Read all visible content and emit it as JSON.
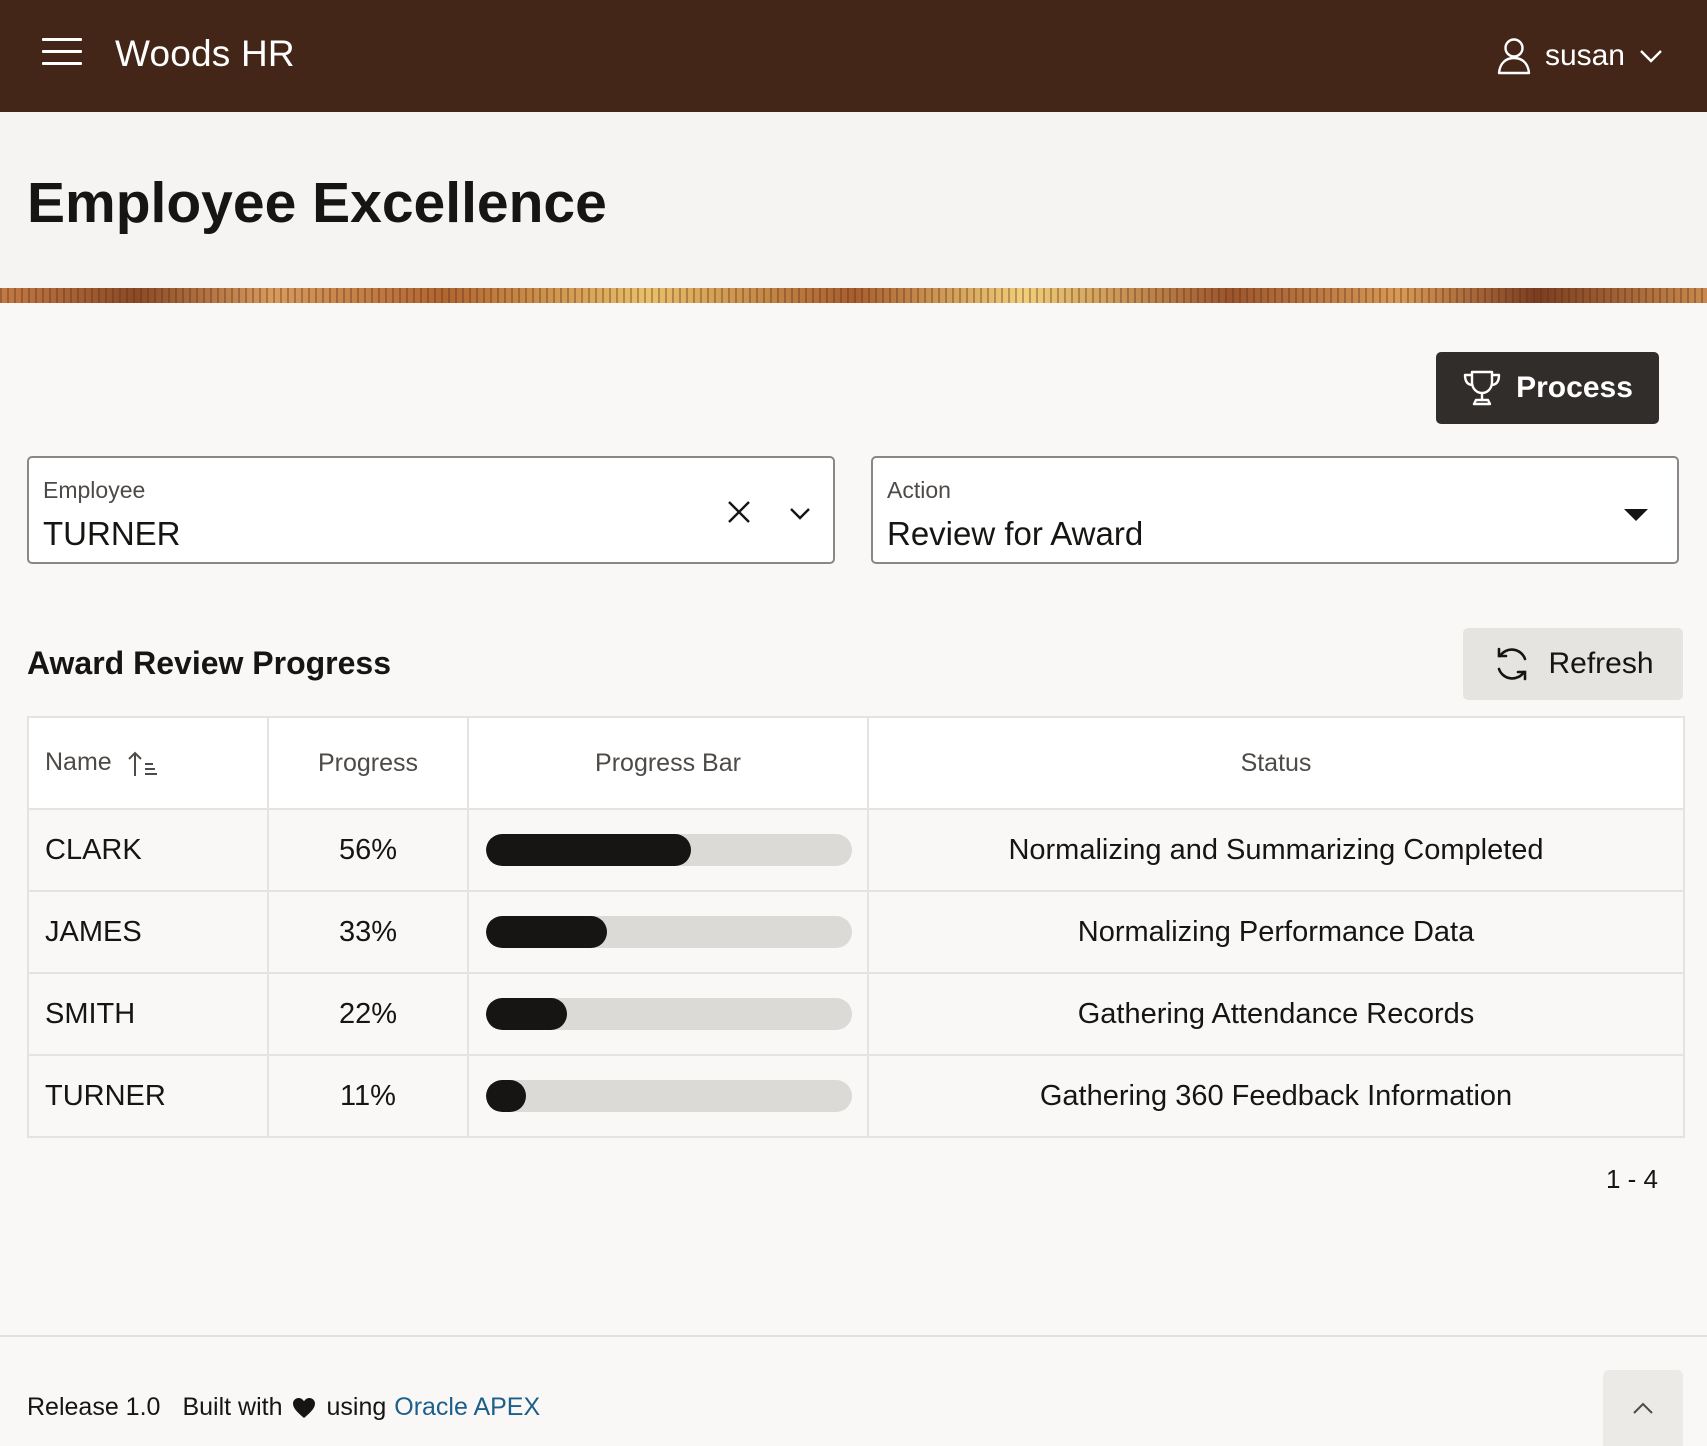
{
  "header": {
    "app_title": "Woods HR",
    "user_name": "susan",
    "icons": {
      "menu": "hamburger-icon",
      "user": "user-icon",
      "dropdown": "chevron-down-icon"
    },
    "bg_color": "#442619"
  },
  "page": {
    "title": "Employee Excellence"
  },
  "toolbar": {
    "process_label": "Process",
    "process_icon": "trophy-icon"
  },
  "form": {
    "employee": {
      "label": "Employee",
      "value": "TURNER"
    },
    "action": {
      "label": "Action",
      "value": "Review for Award"
    }
  },
  "report": {
    "title": "Award Review Progress",
    "refresh_label": "Refresh",
    "columns": [
      "Name",
      "Progress",
      "Progress Bar",
      "Status"
    ],
    "sort": {
      "column": "Name",
      "direction": "ascending"
    },
    "rows": [
      {
        "name": "CLARK",
        "progress": "56%",
        "progress_value": 56,
        "status": "Normalizing and Summarizing Completed"
      },
      {
        "name": "JAMES",
        "progress": "33%",
        "progress_value": 33,
        "status": "Normalizing Performance Data"
      },
      {
        "name": "SMITH",
        "progress": "22%",
        "progress_value": 22,
        "status": "Gathering Attendance Records"
      },
      {
        "name": "TURNER",
        "progress": "11%",
        "progress_value": 11,
        "status": "Gathering 360 Feedback Information"
      }
    ],
    "pagination": "1 - 4"
  },
  "footer": {
    "release": "Release 1.0",
    "built_with": "Built with",
    "using": "using",
    "link_text": "Oracle APEX",
    "link_color": "#1c5f8a"
  }
}
